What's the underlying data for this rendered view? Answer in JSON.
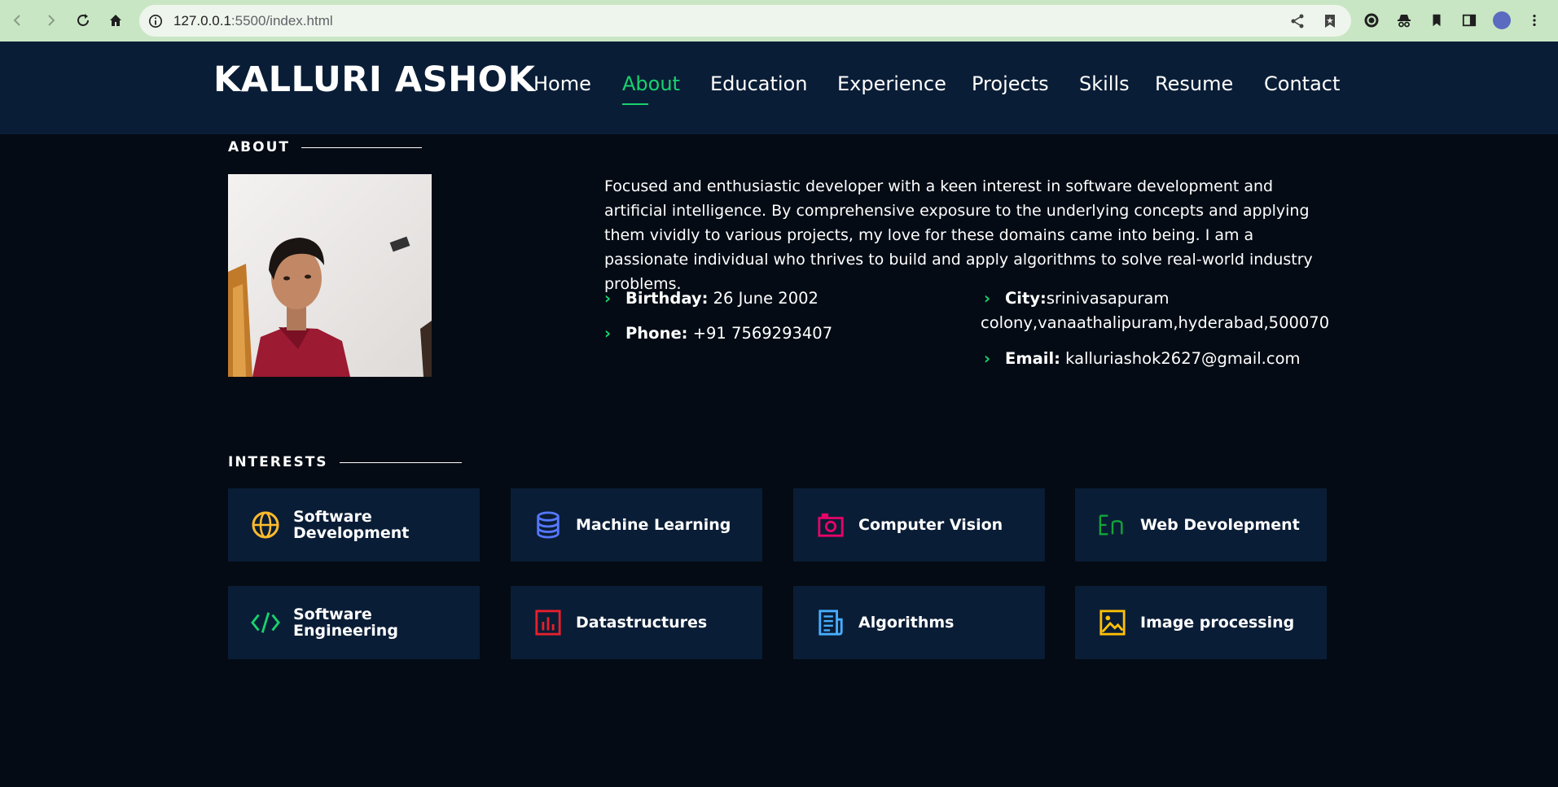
{
  "browser": {
    "url_host": "127.0.0.1",
    "url_path": ":5500/index.html"
  },
  "header": {
    "logo": "KALLURI ASHOK",
    "menu": [
      "Home",
      "About",
      "Education",
      "Experience",
      "Projects",
      "Skills",
      "Resume",
      "Contact"
    ],
    "active": "About"
  },
  "about": {
    "title": "ABOUT",
    "description": "Focused and enthusiastic developer with a keen interest in software development and artificial intelligence. By comprehensive exposure to the underlying concepts and applying them vividly to various projects, my love for these domains came into being. I am a passionate individual who thrives to build and apply algorithms to solve real-world industry problems.",
    "birthday_label": "Birthday:",
    "birthday": "26 June 2002",
    "phone_label": "Phone:",
    "phone": "+91 7569293407",
    "city_label": "City:",
    "city_line1": "srinivasapuram",
    "city_line2": "colony,vanaathalipuram,hyderabad,500070",
    "email_label": "Email:",
    "email": "kalluriashok2627@gmail.com"
  },
  "interests": {
    "title": "INTERESTS",
    "items": [
      {
        "line1": "Software",
        "line2": "Development",
        "icon": "globe-icon",
        "color": "#ffbb2c"
      },
      {
        "line1": "Machine Learning",
        "line2": "",
        "icon": "database-icon",
        "color": "#5578ff"
      },
      {
        "line1": "Computer Vision",
        "line2": "",
        "icon": "camera-icon",
        "color": "#e80368"
      },
      {
        "line1": "Web Devolepment",
        "line2": "",
        "icon": "language-icon",
        "color": "#11a63a"
      },
      {
        "line1": "Software",
        "line2": "Engineering",
        "icon": "code-icon",
        "color": "#18d26e"
      },
      {
        "line1": "Datastructures",
        "line2": "",
        "icon": "bar-chart-icon",
        "color": "#e81f2c"
      },
      {
        "line1": "Algorithms",
        "line2": "",
        "icon": "document-icon",
        "color": "#47aeff"
      },
      {
        "line1": "Image processing",
        "line2": "",
        "icon": "image-icon",
        "color": "#ffc107"
      }
    ]
  }
}
